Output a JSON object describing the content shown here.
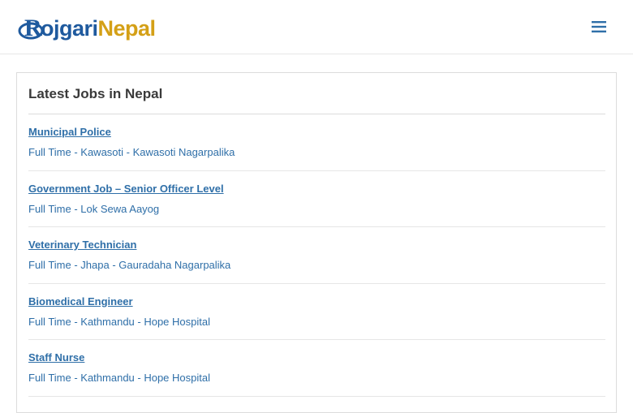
{
  "header": {
    "logo": {
      "part1": "ojgari",
      "part2": "Nepal",
      "initial": "R"
    },
    "menu_icon": "hamburger-menu-icon"
  },
  "colors": {
    "link": "#2f6fa8",
    "logo_blue": "#1f5a9e",
    "logo_gold": "#d4a017",
    "border": "#dcdcdc"
  },
  "latest_jobs": {
    "title": "Latest Jobs in Nepal",
    "items": [
      {
        "title": "Municipal Police",
        "meta": "Full Time - Kawasoti - Kawasoti Nagarpalika"
      },
      {
        "title": "Government Job – Senior Officer Level",
        "meta": "Full Time - Lok Sewa Aayog"
      },
      {
        "title": "Veterinary Technician",
        "meta": "Full Time - Jhapa - Gauradaha Nagarpalika"
      },
      {
        "title": "Biomedical Engineer",
        "meta": "Full Time - Kathmandu - Hope Hospital"
      },
      {
        "title": "Staff Nurse",
        "meta": "Full Time - Kathmandu - Hope Hospital"
      }
    ]
  }
}
